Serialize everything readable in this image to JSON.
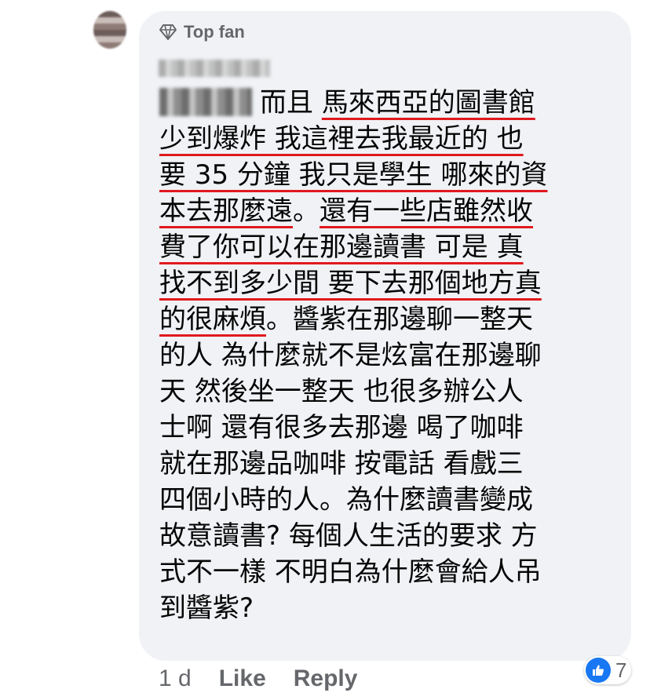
{
  "badge": {
    "label": "Top fan",
    "icon": "diamond-icon"
  },
  "comment": {
    "lines": [
      {
        "segments": [
          {
            "text": "而且 ",
            "underline": false
          },
          {
            "text": "馬來西亞的圖書館",
            "underline": true
          }
        ]
      },
      {
        "segments": [
          {
            "text": "少到爆炸 我這裡去我最近的 也",
            "underline": true
          }
        ]
      },
      {
        "segments": [
          {
            "text": "要 35 分鐘 我只是學生 哪來的資",
            "underline": true
          }
        ]
      },
      {
        "segments": [
          {
            "text": "本去那麼遠",
            "underline": true
          },
          {
            "text": "。",
            "underline": false
          },
          {
            "text": "還有一些店雖然收",
            "underline": true
          }
        ]
      },
      {
        "segments": [
          {
            "text": "費了你可以在那邊讀書 可是 真",
            "underline": true
          }
        ]
      },
      {
        "segments": [
          {
            "text": "找不到多少間 要下去那個地方真",
            "underline": true
          }
        ]
      },
      {
        "segments": [
          {
            "text": "的很麻煩",
            "underline": true
          },
          {
            "text": "。醬紫在那邊聊一整天",
            "underline": false
          }
        ]
      },
      {
        "segments": [
          {
            "text": "的人 為什麼就不是炫富在那邊聊",
            "underline": false
          }
        ]
      },
      {
        "segments": [
          {
            "text": "天 然後坐一整天 也很多辦公人",
            "underline": false
          }
        ]
      },
      {
        "segments": [
          {
            "text": "士啊 還有很多去那邊 喝了咖啡",
            "underline": false
          }
        ]
      },
      {
        "segments": [
          {
            "text": "就在那邊品咖啡 按電話 看戲三",
            "underline": false
          }
        ]
      },
      {
        "segments": [
          {
            "text": "四個小時的人。為什麼讀書變成",
            "underline": false
          }
        ]
      },
      {
        "segments": [
          {
            "text": "故意讀書? 每個人生活的要求 方",
            "underline": false
          }
        ]
      },
      {
        "segments": [
          {
            "text": "式不一樣 不明白為什麼會給人吊",
            "underline": false
          }
        ]
      },
      {
        "segments": [
          {
            "text": "到醬紫?",
            "underline": false
          }
        ]
      }
    ]
  },
  "actions": {
    "time": "1 d",
    "like": "Like",
    "reply": "Reply"
  },
  "reactions": {
    "icon": "thumbs-up-icon",
    "count": "7"
  },
  "colors": {
    "accent": "#1877f2",
    "underline": "#e0191e",
    "bubble": "#f0f2f5",
    "muted": "#65676b"
  }
}
